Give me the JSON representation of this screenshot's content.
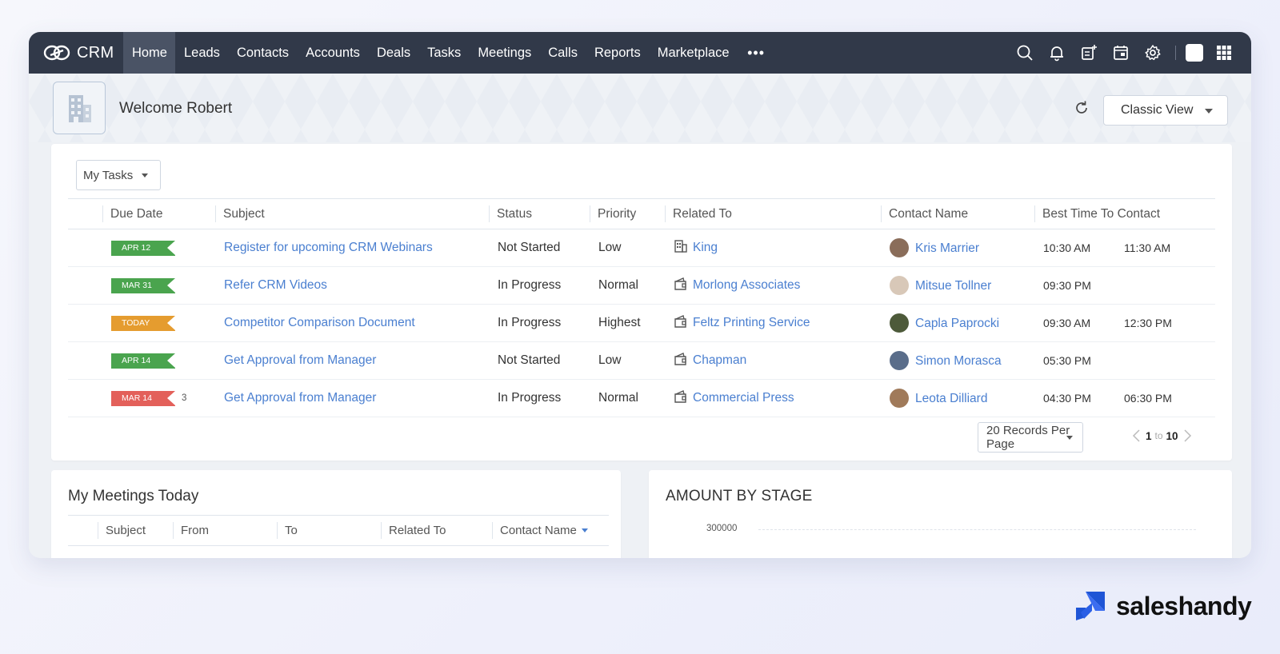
{
  "app": {
    "brand": "CRM"
  },
  "nav": {
    "items": [
      {
        "label": "Home",
        "active": true
      },
      {
        "label": "Leads"
      },
      {
        "label": "Contacts"
      },
      {
        "label": "Accounts"
      },
      {
        "label": "Deals"
      },
      {
        "label": "Tasks"
      },
      {
        "label": "Meetings"
      },
      {
        "label": "Calls"
      },
      {
        "label": "Reports"
      },
      {
        "label": "Marketplace"
      }
    ],
    "more": "•••"
  },
  "welcome": {
    "text": "Welcome Robert",
    "view_button": "Classic View"
  },
  "tasks": {
    "filter_label": "My Tasks",
    "columns": [
      "Due Date",
      "Subject",
      "Status",
      "Priority",
      "Related To",
      "Contact Name",
      "Best Time To Contact"
    ],
    "rows": [
      {
        "due": "APR 12",
        "flag": "green",
        "count": "",
        "subject": "Register for upcoming CRM Webinars",
        "status": "Not Started",
        "priority": "Low",
        "related": "King",
        "related_icon": "building-icon",
        "contact": "Kris Marrier",
        "avatar": "#8a6d5a",
        "time_from": "10:30 AM",
        "time_to": "11:30 AM"
      },
      {
        "due": "MAR 31",
        "flag": "green",
        "count": "",
        "subject": "Refer CRM Videos",
        "status": "In Progress",
        "priority": "Normal",
        "related": "Morlong Associates",
        "related_icon": "wallet-icon",
        "contact": "Mitsue Tollner",
        "avatar": "#d8c8b8",
        "time_from": "09:30 PM",
        "time_to": ""
      },
      {
        "due": "TODAY",
        "flag": "orange",
        "count": "",
        "subject": "Competitor Comparison Document",
        "status": "In Progress",
        "priority": "Highest",
        "related": "Feltz Printing Service",
        "related_icon": "wallet-icon",
        "contact": "Capla Paprocki",
        "avatar": "#4d5a3a",
        "time_from": "09:30 AM",
        "time_to": "12:30 PM"
      },
      {
        "due": "APR 14",
        "flag": "green",
        "count": "",
        "subject": "Get Approval from Manager",
        "status": "Not Started",
        "priority": "Low",
        "related": "Chapman",
        "related_icon": "wallet-icon",
        "contact": "Simon Morasca",
        "avatar": "#5a6d8a",
        "time_from": "05:30 PM",
        "time_to": ""
      },
      {
        "due": "MAR 14",
        "flag": "red",
        "count": "3",
        "subject": "Get Approval from Manager",
        "status": "In Progress",
        "priority": "Normal",
        "related": "Commercial Press",
        "related_icon": "wallet-icon",
        "contact": "Leota Dilliard",
        "avatar": "#a07a5a",
        "time_from": "04:30 PM",
        "time_to": "06:30 PM"
      }
    ],
    "records_per_page": "20 Records Per Page",
    "page_from": "1",
    "page_to_word": "to",
    "page_to": "10"
  },
  "meetings": {
    "title": "My Meetings Today",
    "columns": [
      "Subject",
      "From",
      "To",
      "Related To",
      "Contact Name"
    ]
  },
  "amount_by_stage": {
    "title": "AMOUNT BY STAGE",
    "tick": "300000"
  },
  "footer_brand": {
    "text": "saleshandy"
  }
}
